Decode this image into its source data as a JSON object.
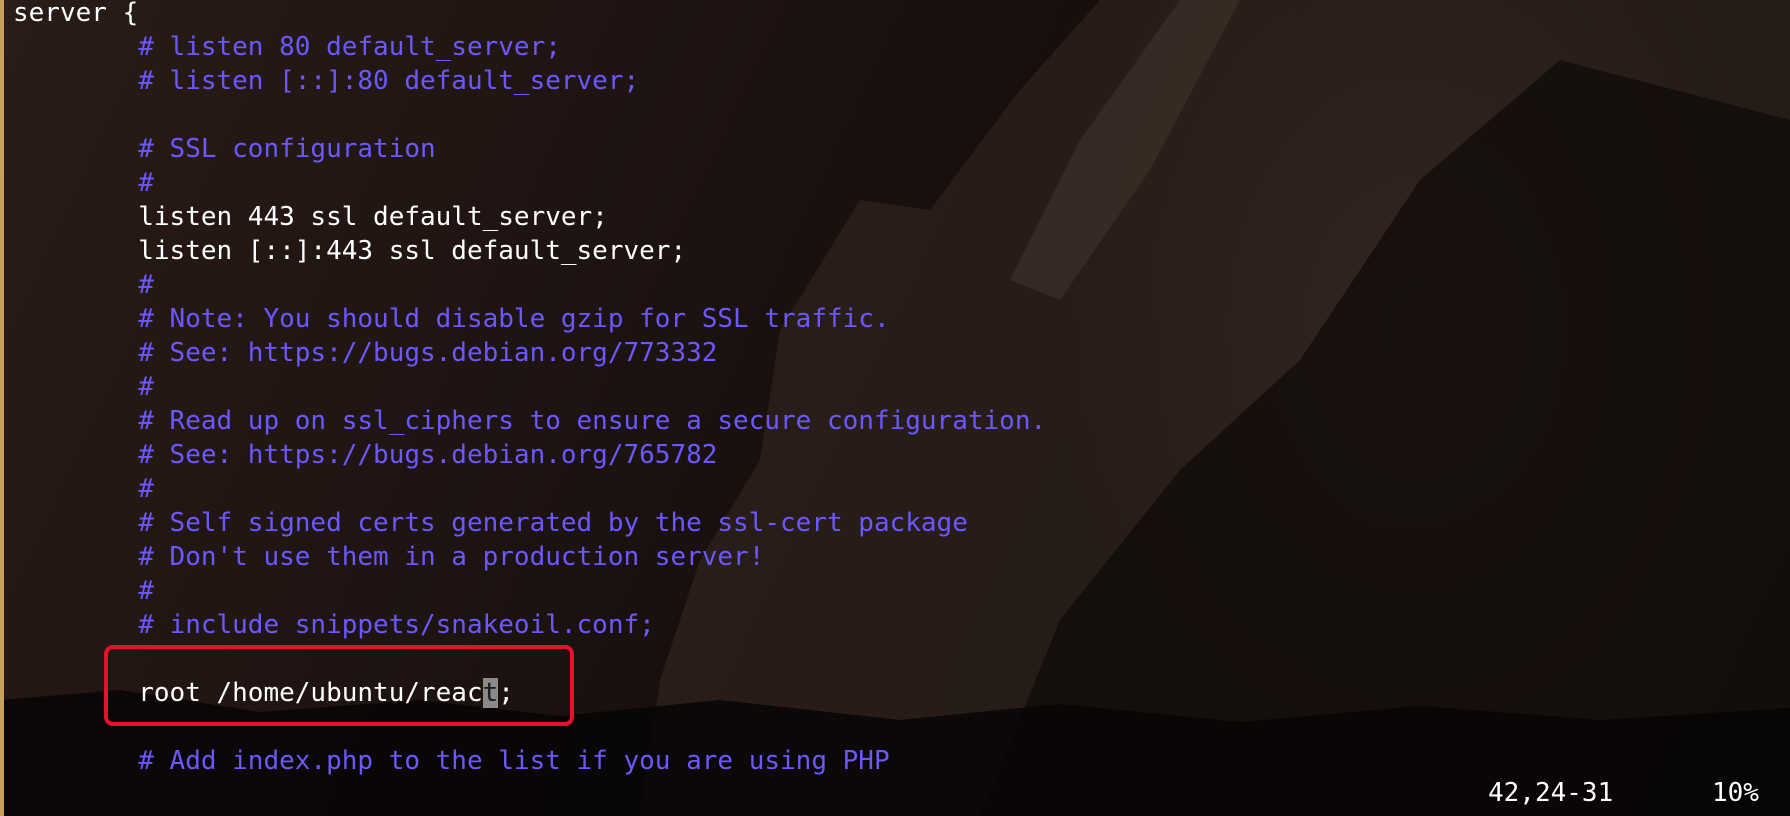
{
  "editor": {
    "lines": [
      {
        "kind": "code",
        "indent": "",
        "text": "server {"
      },
      {
        "kind": "comment",
        "indent": "        ",
        "text": "# listen 80 default_server;"
      },
      {
        "kind": "comment",
        "indent": "        ",
        "text": "# listen [::]:80 default_server;"
      },
      {
        "kind": "blank",
        "indent": "",
        "text": ""
      },
      {
        "kind": "comment",
        "indent": "        ",
        "text": "# SSL configuration"
      },
      {
        "kind": "comment",
        "indent": "        ",
        "text": "#"
      },
      {
        "kind": "code",
        "indent": "        ",
        "text": "listen 443 ssl default_server;"
      },
      {
        "kind": "code",
        "indent": "        ",
        "text": "listen [::]:443 ssl default_server;"
      },
      {
        "kind": "comment",
        "indent": "        ",
        "text": "#"
      },
      {
        "kind": "comment",
        "indent": "        ",
        "text": "# Note: You should disable gzip for SSL traffic."
      },
      {
        "kind": "comment",
        "indent": "        ",
        "text": "# See: https://bugs.debian.org/773332"
      },
      {
        "kind": "comment",
        "indent": "        ",
        "text": "#"
      },
      {
        "kind": "comment",
        "indent": "        ",
        "text": "# Read up on ssl_ciphers to ensure a secure configuration."
      },
      {
        "kind": "comment",
        "indent": "        ",
        "text": "# See: https://bugs.debian.org/765782"
      },
      {
        "kind": "comment",
        "indent": "        ",
        "text": "#"
      },
      {
        "kind": "comment",
        "indent": "        ",
        "text": "# Self signed certs generated by the ssl-cert package"
      },
      {
        "kind": "comment",
        "indent": "        ",
        "text": "# Don't use them in a production server!"
      },
      {
        "kind": "comment",
        "indent": "        ",
        "text": "#"
      },
      {
        "kind": "comment",
        "indent": "        ",
        "text": "# include snippets/snakeoil.conf;"
      },
      {
        "kind": "blank",
        "indent": "",
        "text": ""
      },
      {
        "kind": "cursor",
        "indent": "        ",
        "text_before": "root /home/ubuntu/reac",
        "cursor_char": "t",
        "text_after": ";"
      },
      {
        "kind": "blank",
        "indent": "",
        "text": ""
      },
      {
        "kind": "comment",
        "indent": "        ",
        "text": "# Add index.php to the list if you are using PHP"
      }
    ]
  },
  "status_bar": {
    "position": "42,24-31",
    "percent": "10%"
  },
  "colors": {
    "comment": "#6b58ff",
    "code": "#ffffff",
    "highlight_box": "#e8102a",
    "cursor": "#8a8a8a"
  }
}
